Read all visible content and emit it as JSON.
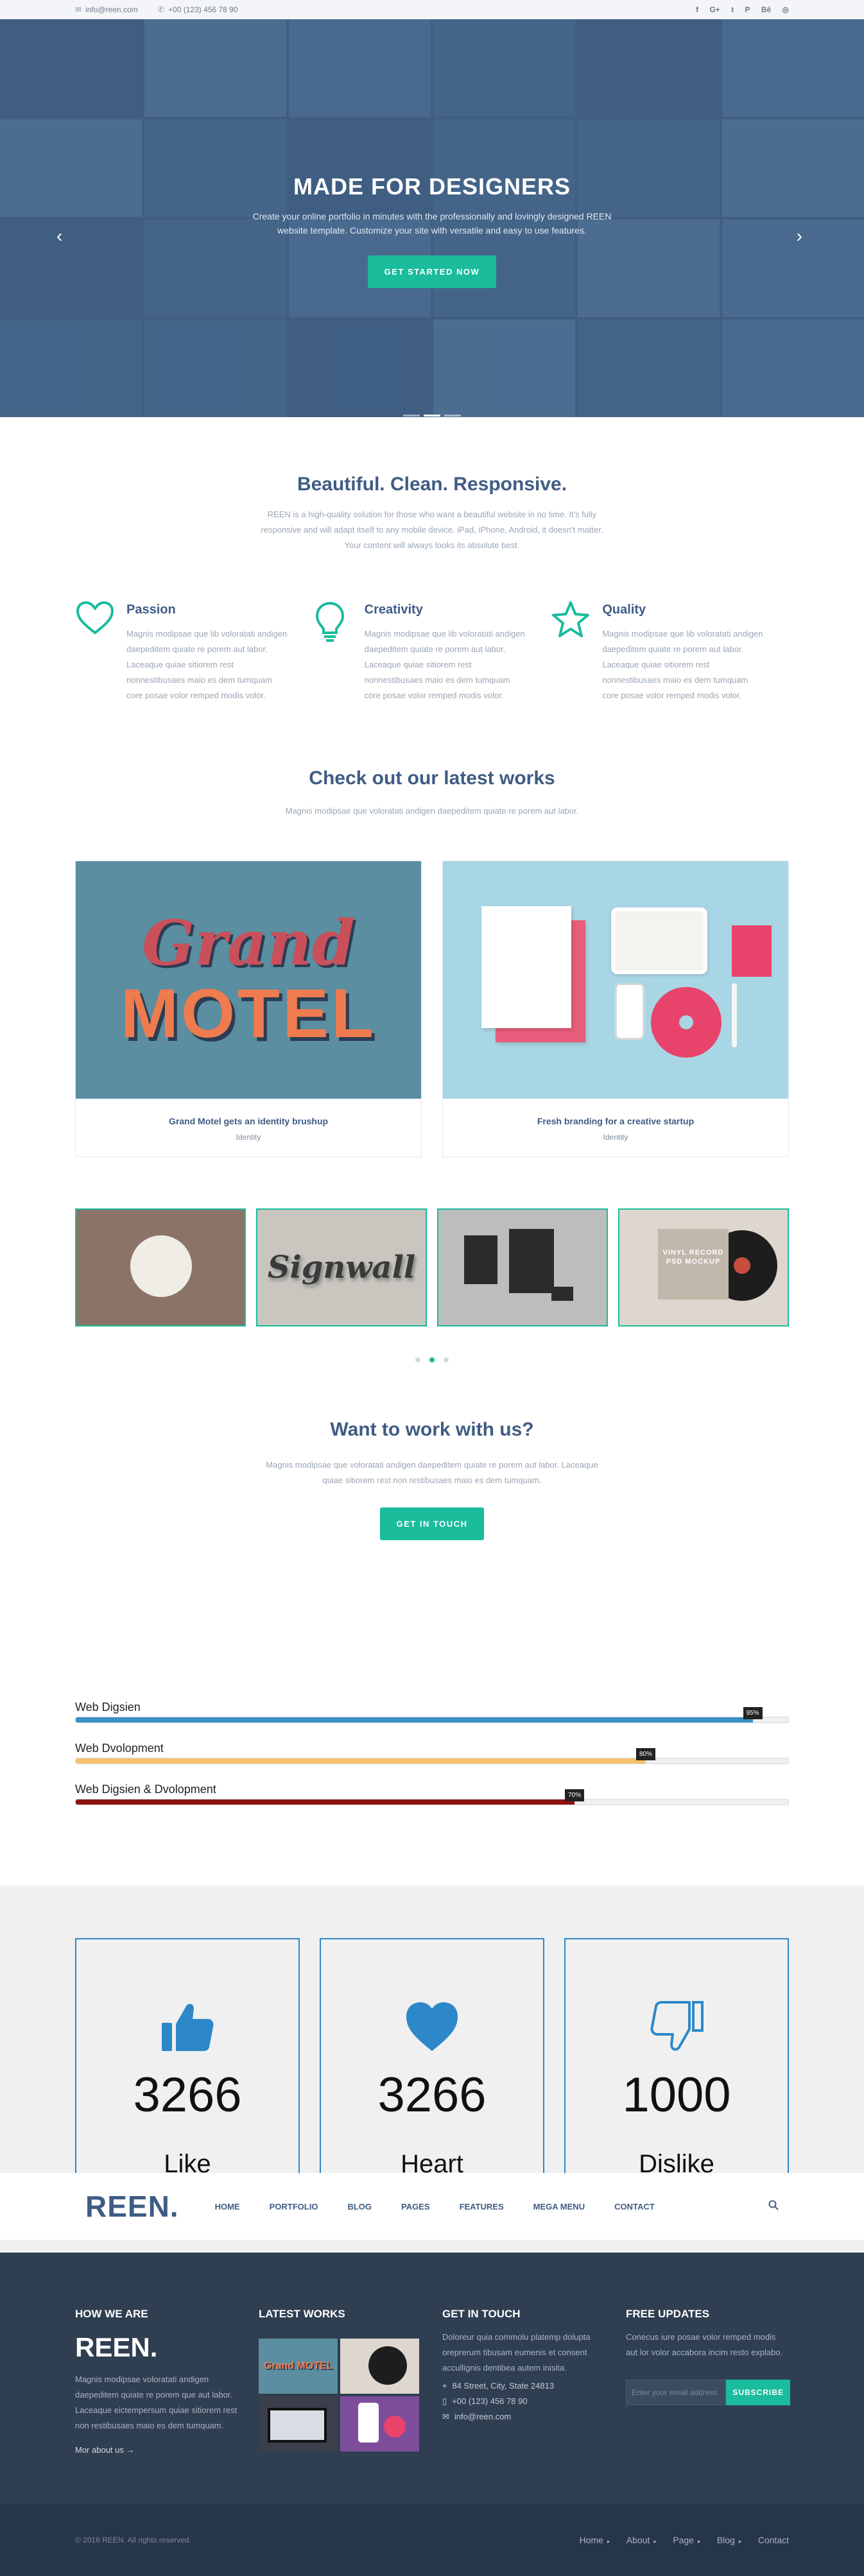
{
  "topbar": {
    "email_icon": "envelope-icon",
    "email": "info@reen.com",
    "phone_icon": "phone-icon",
    "phone": "+00 (123) 456 78 90",
    "social": [
      "f",
      "G+",
      "t",
      "P",
      "Bē",
      "◎"
    ]
  },
  "hero": {
    "title": "MADE FOR DESIGNERS",
    "text": "Create your online portfolio in minutes with the professionally and lovingly designed REEN website template. Customize your site with versatile and easy to use features.",
    "button": "GET STARTED NOW",
    "prev_icon": "‹",
    "next_icon": "›",
    "overlay_color": "#3f5e84"
  },
  "intro": {
    "title": "Beautiful. Clean. Responsive.",
    "text": "REEN is a high-quality solution for those who want a beautiful website in no time. It's fully responsive and will adapt itself to any mobile device. iPad, iPhone, Android, it doesn't matter. Your content will always looks its absolute best."
  },
  "features": [
    {
      "icon": "heart-icon",
      "title": "Passion",
      "text": "Magnis modipsae que lib voloratati andigen daepeditem quiate re porem aut labor. Laceaque quiae sitiorem rest nonnestibusaes maio es dem tumquam core posae volor remped modis volor."
    },
    {
      "icon": "lightbulb-icon",
      "title": "Creativity",
      "text": "Magnis modipsae que lib voloratati andigen daepeditem quiate re porem aut labor. Laceaque quiae sitiorem rest nonnestibusaes maio es dem tumquam core posae volor remped modis volor."
    },
    {
      "icon": "star-icon",
      "title": "Quality",
      "text": "Magnis modipsae que lib voloratati andigen daepeditem quiate re porem aut labor. Laceaque quiae sitiorem rest nonnestibusaes maio es dem tumquam core posae volor remped modis volor."
    }
  ],
  "works": {
    "title": "Check out our latest works",
    "subtitle": "Magnis modipsae que voloratati andigen daepeditem quiate re porem aut labor.",
    "items": [
      {
        "title": "Grand Motel gets an identity brushup",
        "category": "Identity",
        "art_line1": "Grand",
        "art_line2": "MOTEL"
      },
      {
        "title": "Fresh branding for a creative startup",
        "category": "Identity"
      }
    ],
    "thumbs": [
      {
        "name": "badge"
      },
      {
        "name": "signwall",
        "art": "Signwall"
      },
      {
        "name": "stationery"
      },
      {
        "name": "vinyl",
        "art": "VINYL RECORD PSD MOCKUP"
      }
    ]
  },
  "cta": {
    "title": "Want to work with us?",
    "text": "Magnis modipsae que voloratati andigen daepeditem quiate re porem aut labor. Laceaque quiae sitiorem rest non restibusaes maio es dem tumquam.",
    "button": "GET IN TOUCH"
  },
  "skills": [
    {
      "label": "Web Digsien",
      "value": 95,
      "pct_label": "95%",
      "color": "#3b8fc4"
    },
    {
      "label": "Web Dvolopment",
      "value": 80,
      "pct_label": "80%",
      "color": "#f5c26b"
    },
    {
      "label": "Web Digsien & Dvolopment",
      "value": 70,
      "pct_label": "70%",
      "color": "#8e1313"
    }
  ],
  "counters": [
    {
      "icon": "thumbs-up-icon",
      "number": "3266",
      "label": "Like"
    },
    {
      "icon": "heart-icon",
      "number": "3266",
      "label": "Heart"
    },
    {
      "icon": "thumbs-down-icon",
      "number": "1000",
      "label": "Dislike"
    }
  ],
  "nav": {
    "logo": "REEN.",
    "items": [
      "HOME",
      "PORTFOLIO",
      "BLOG",
      "PAGES",
      "FEATURES",
      "MEGA MENU",
      "CONTACT"
    ],
    "search_icon": "search-icon"
  },
  "footer": {
    "col1": {
      "title": "HOW WE ARE",
      "logo": "REEN.",
      "text": "Magnis modipsae voloratati andigen daepeditem quiate re porem que aut labor. Laceaque eictempersum quiae sitiorem rest non restibusaes maio es dem tumquam.",
      "more": "Mor about us →"
    },
    "col2": {
      "title": "LATEST WORKS",
      "art": "Grand MOTEL"
    },
    "col3": {
      "title": "GET IN TOUCH",
      "text": "Doloreur quia commolu platemp dolupta oreprerum tibusam eumenis et consent accullignis dentibea autem inisita.",
      "address": "84 Street, City, State 24813",
      "phone": "+00 (123) 456 78 90",
      "email": "info@reen.com"
    },
    "col4": {
      "title": "FREE UPDATES",
      "text": "Conecus iure posae volor remped modis aut lor volor accabora incim resto explabo.",
      "placeholder": "Enter your email address",
      "button": "SUBSCRIBE"
    }
  },
  "bottom": {
    "copyright": "© 2016 REEN. All rights reserved.",
    "links": [
      "Home",
      "About",
      "Page",
      "Blog",
      "Contact"
    ]
  }
}
